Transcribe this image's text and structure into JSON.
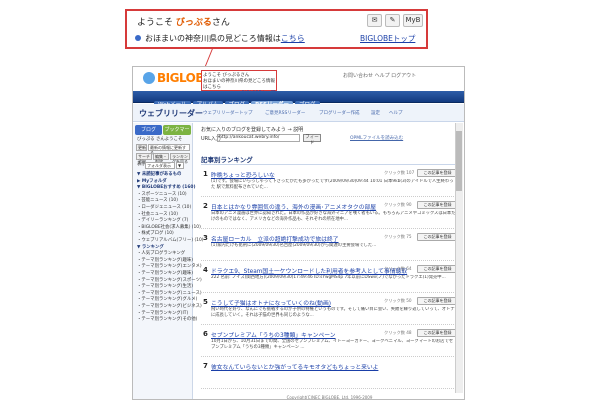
{
  "callout": {
    "greeting_prefix": "ようこそ ",
    "user": "びっぷる",
    "greeting_suffix": "さん",
    "btn_mail": "✉",
    "btn_note": "✎",
    "btn_my": "MyB",
    "info_prefix": "おほまいの神奈川県の見どころ情報は",
    "info_link": "こちら",
    "top_link": "BIGLOBEトップ"
  },
  "header": {
    "logo": "BIGLOBE",
    "links": "お問い合わせ   ヘルプ   ログアウト",
    "mini_line1": "ようこそ びっぷるさん",
    "mini_line2": "おほまいの神奈川県の見どころ情報はこちら",
    "mini_line3": "BIGLOBEトップ"
  },
  "nav": {
    "tabs": [
      "Webメール",
      "アルバム",
      "ブログ",
      "RSSリーダー",
      "ブログ"
    ],
    "active_index": 3
  },
  "section": {
    "title": "ウェブリリーダー",
    "links": [
      "ウェブリリーダートップ",
      "ご意見RSSリーダー",
      "ブログリーダー作成",
      "設定",
      "ヘルプ"
    ]
  },
  "sidebar": {
    "btn_blog": "ブログ",
    "btn_bookmark": "ブックマーク",
    "user": "びっぷる さんようこそ",
    "btn_update": "更新",
    "update_note": "最新の情報に更新する",
    "btn_search": "サーチ追加",
    "btn_edit": "編集・削除",
    "btn_rank": "ランキングを見る",
    "show_label": "表示",
    "show_value": "フォルダ表示",
    "show_go": "▼",
    "rows": [
      {
        "text": "▼ 未読記事があるもの",
        "head": true
      },
      {
        "text": "▶ Myフォルダ",
        "head": true
      },
      {
        "text": "▼ BIGLOBEおすすめ (160)",
        "head": true
      },
      {
        "text": "  ・スポーツニュース (10)",
        "head": false
      },
      {
        "text": "  ・芸能ニュース (10)",
        "head": false
      },
      {
        "text": "  ・ローダジェニュース (10)",
        "head": false
      },
      {
        "text": "  ・社会ニュース (10)",
        "head": false
      },
      {
        "text": "  ・デイリーランキング (7)",
        "head": false
      },
      {
        "text": "  ・BIGLOBE社会(求人募集) (10)",
        "head": false
      },
      {
        "text": "  ・株式ブログ (10)",
        "head": false
      },
      {
        "text": "  ・ウェブリアルバム(フリー) (10)",
        "head": false
      },
      {
        "text": "▼ ランキング",
        "head": true
      },
      {
        "text": "  ・人気ブログランキング",
        "head": false
      },
      {
        "text": "  ・テーマ別ランキング(趣味)",
        "head": false
      },
      {
        "text": "  ・テーマ別ランキング(エンタメ)",
        "head": false
      },
      {
        "text": "  ・テーマ別ランキング(趣味)",
        "head": false
      },
      {
        "text": "  ・テーマ別ランキング(スポーツ)",
        "head": false
      },
      {
        "text": "  ・テーマ別ランキング(生活)",
        "head": false
      },
      {
        "text": "  ・テーマ別ランキング(ニュース)",
        "head": false
      },
      {
        "text": "  ・テーマ別ランキング(グルメ)",
        "head": false
      },
      {
        "text": "  ・テーマ別ランキング(ビジネス)",
        "head": false
      },
      {
        "text": "  ・テーマ別ランキング(IT)",
        "head": false
      },
      {
        "text": "  ・テーマ別ランキング(その他)",
        "head": false
      }
    ]
  },
  "main": {
    "intro": "お気に入りのブログを登録してみよう → 説明",
    "url_label": "URL入力",
    "url_value": "http://ankoucat.webry.info/",
    "submit": "フィード",
    "opml": "OPMLファイルを読み込む",
    "rank_title": "記事別ランキング",
    "entries": [
      {
        "num": "1",
        "title": "昨晩ちょっと恐ろしいな",
        "clicks": "クリック数 107",
        "reg": "この記事を登録",
        "desc": "(1)です。会場にいらっしゃって下さったかたも多かったです(2009/09/30)09:44 10:01 日本9kb(3)のアイドルで人生終わった 駅で無料配布されていた..."
      },
      {
        "num": "2",
        "title": "日本とはかなり雰囲気の違う、海外の漫画･アニメオタクの部屋",
        "clicks": "クリック数 90",
        "reg": "この記事を登録",
        "desc": "日本のアニメ漫画は世界に認知された。日本の作品が好きな海外マニアを嘆く者もいる。もちろんアニメやコミックスは日本だけのものではなく、アメリカなどの海外作品も、それぞれの所在地中..."
      },
      {
        "num": "3",
        "title": "名古屋ローカル　立派の超絶打撃成功で旅は終了",
        "clicks": "クリック数 75",
        "reg": "この記事を登録",
        "desc": "(1)家内たけも処刑に(2009/09/30)名古屋(2009/09/30)から関連の主要会場でした..."
      },
      {
        "num": "4",
        "title": "ドラクエ9、Steam国土一ケウンロードした利用者を参考人として事情聴取",
        "clicks": "クリック数 64",
        "reg": "この記事を登録",
        "desc": "222 名前: ノイズ(関西地方)(2009/09/30)17:49:46 ID:sYwgMS4p 7年以前にDSwii(ノ)でなかったドラクエ(1)発売中..."
      },
      {
        "num": "5",
        "title": "こうして子猫はオトナになっていくのね(動画)",
        "clicks": "クリック数 50",
        "reg": "この記事を登録",
        "desc": "飛い時代を好り、なんにでも挑戦するのが子供の特権というものです。そして痛い目に会い、失敗を繰り返していって、オトナに成長していく。それは子猫の世界も同じのような..."
      },
      {
        "num": "6",
        "title": "セブンプレミアム「うちの3種類」キャンペーン",
        "clicks": "クリック数 48",
        "reg": "この記事を登録",
        "desc": "10月1日から、10月31日までの間、全国のセブンプレミアム、イトーヨーカドー、ヨークベニマル、ヨークマートのお店でセブンプレミアム「うちの3種類」キャンペーン ..."
      },
      {
        "num": "7",
        "title": "彼女なんていらないとか強がってるキモオタどもちょっと来いよ",
        "clicks": "",
        "reg": "",
        "desc": ""
      }
    ]
  },
  "footer": "Copyright(C)NEC BIGLOBE, Ltd. 1996-2009"
}
